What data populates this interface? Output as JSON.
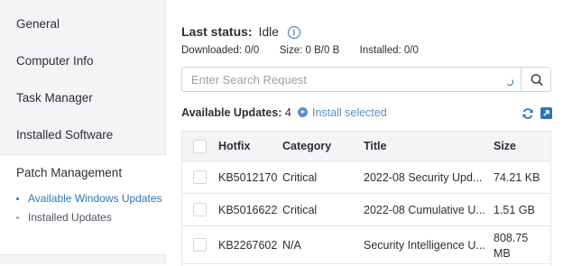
{
  "sidebar": {
    "items": [
      {
        "label": "General"
      },
      {
        "label": "Computer Info"
      },
      {
        "label": "Task Manager"
      },
      {
        "label": "Installed Software"
      },
      {
        "label": "Patch Management"
      }
    ],
    "sub_items": [
      {
        "label": "Available Windows Updates",
        "active": true
      },
      {
        "label": "Installed Updates",
        "active": false
      }
    ]
  },
  "status": {
    "label": "Last status:",
    "value": "Idle",
    "downloaded_label": "Downloaded:",
    "downloaded_value": "0/0",
    "size_label": "Size:",
    "size_value": "0 B/0 B",
    "installed_label": "Installed:",
    "installed_value": "0/0"
  },
  "search": {
    "placeholder": "Enter Search Request",
    "value": ""
  },
  "updates": {
    "count_label": "Available Updates:",
    "count": "4",
    "install_selected_label": "Install selected"
  },
  "table": {
    "headers": {
      "hotfix": "Hotfix",
      "category": "Category",
      "title": "Title",
      "size": "Size"
    },
    "rows": [
      {
        "hotfix": "KB5012170",
        "category": "Critical",
        "title": "2022-08 Security Upd...",
        "size": "74.21 KB"
      },
      {
        "hotfix": "KB5016622",
        "category": "Critical",
        "title": "2022-08 Cumulative U...",
        "size": "1.51 GB"
      },
      {
        "hotfix": "KB2267602",
        "category": "N/A",
        "title": "Security Intelligence U...",
        "size": "808.75 MB"
      }
    ]
  },
  "colors": {
    "accent": "#2d74b9",
    "install_link": "#5b8fc9",
    "sidebar_bg": "#f3f4f6"
  },
  "icons": [
    "info-icon",
    "spinner-icon",
    "search-icon",
    "refresh-icon",
    "export-icon",
    "play-icon"
  ]
}
